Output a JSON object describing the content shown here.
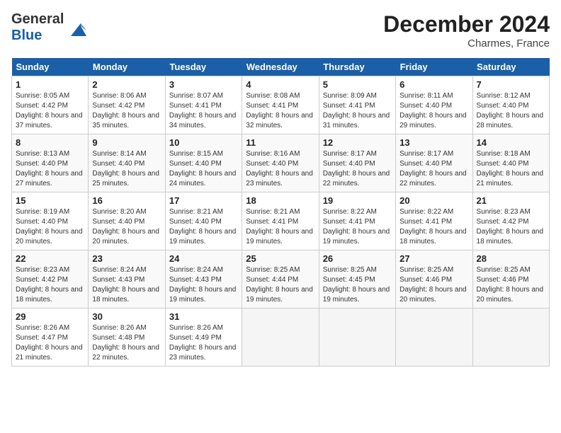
{
  "header": {
    "logo_general": "General",
    "logo_blue": "Blue",
    "month_year": "December 2024",
    "location": "Charmes, France"
  },
  "weekdays": [
    "Sunday",
    "Monday",
    "Tuesday",
    "Wednesday",
    "Thursday",
    "Friday",
    "Saturday"
  ],
  "weeks": [
    [
      {
        "day": 1,
        "sunrise": "8:05 AM",
        "sunset": "4:42 PM",
        "daylight": "8 hours and 37 minutes."
      },
      {
        "day": 2,
        "sunrise": "8:06 AM",
        "sunset": "4:42 PM",
        "daylight": "8 hours and 35 minutes."
      },
      {
        "day": 3,
        "sunrise": "8:07 AM",
        "sunset": "4:41 PM",
        "daylight": "8 hours and 34 minutes."
      },
      {
        "day": 4,
        "sunrise": "8:08 AM",
        "sunset": "4:41 PM",
        "daylight": "8 hours and 32 minutes."
      },
      {
        "day": 5,
        "sunrise": "8:09 AM",
        "sunset": "4:41 PM",
        "daylight": "8 hours and 31 minutes."
      },
      {
        "day": 6,
        "sunrise": "8:11 AM",
        "sunset": "4:40 PM",
        "daylight": "8 hours and 29 minutes."
      },
      {
        "day": 7,
        "sunrise": "8:12 AM",
        "sunset": "4:40 PM",
        "daylight": "8 hours and 28 minutes."
      }
    ],
    [
      {
        "day": 8,
        "sunrise": "8:13 AM",
        "sunset": "4:40 PM",
        "daylight": "8 hours and 27 minutes."
      },
      {
        "day": 9,
        "sunrise": "8:14 AM",
        "sunset": "4:40 PM",
        "daylight": "8 hours and 25 minutes."
      },
      {
        "day": 10,
        "sunrise": "8:15 AM",
        "sunset": "4:40 PM",
        "daylight": "8 hours and 24 minutes."
      },
      {
        "day": 11,
        "sunrise": "8:16 AM",
        "sunset": "4:40 PM",
        "daylight": "8 hours and 23 minutes."
      },
      {
        "day": 12,
        "sunrise": "8:17 AM",
        "sunset": "4:40 PM",
        "daylight": "8 hours and 22 minutes."
      },
      {
        "day": 13,
        "sunrise": "8:17 AM",
        "sunset": "4:40 PM",
        "daylight": "8 hours and 22 minutes."
      },
      {
        "day": 14,
        "sunrise": "8:18 AM",
        "sunset": "4:40 PM",
        "daylight": "8 hours and 21 minutes."
      }
    ],
    [
      {
        "day": 15,
        "sunrise": "8:19 AM",
        "sunset": "4:40 PM",
        "daylight": "8 hours and 20 minutes."
      },
      {
        "day": 16,
        "sunrise": "8:20 AM",
        "sunset": "4:40 PM",
        "daylight": "8 hours and 20 minutes."
      },
      {
        "day": 17,
        "sunrise": "8:21 AM",
        "sunset": "4:40 PM",
        "daylight": "8 hours and 19 minutes."
      },
      {
        "day": 18,
        "sunrise": "8:21 AM",
        "sunset": "4:41 PM",
        "daylight": "8 hours and 19 minutes."
      },
      {
        "day": 19,
        "sunrise": "8:22 AM",
        "sunset": "4:41 PM",
        "daylight": "8 hours and 19 minutes."
      },
      {
        "day": 20,
        "sunrise": "8:22 AM",
        "sunset": "4:41 PM",
        "daylight": "8 hours and 18 minutes."
      },
      {
        "day": 21,
        "sunrise": "8:23 AM",
        "sunset": "4:42 PM",
        "daylight": "8 hours and 18 minutes."
      }
    ],
    [
      {
        "day": 22,
        "sunrise": "8:23 AM",
        "sunset": "4:42 PM",
        "daylight": "8 hours and 18 minutes."
      },
      {
        "day": 23,
        "sunrise": "8:24 AM",
        "sunset": "4:43 PM",
        "daylight": "8 hours and 18 minutes."
      },
      {
        "day": 24,
        "sunrise": "8:24 AM",
        "sunset": "4:43 PM",
        "daylight": "8 hours and 19 minutes."
      },
      {
        "day": 25,
        "sunrise": "8:25 AM",
        "sunset": "4:44 PM",
        "daylight": "8 hours and 19 minutes."
      },
      {
        "day": 26,
        "sunrise": "8:25 AM",
        "sunset": "4:45 PM",
        "daylight": "8 hours and 19 minutes."
      },
      {
        "day": 27,
        "sunrise": "8:25 AM",
        "sunset": "4:46 PM",
        "daylight": "8 hours and 20 minutes."
      },
      {
        "day": 28,
        "sunrise": "8:25 AM",
        "sunset": "4:46 PM",
        "daylight": "8 hours and 20 minutes."
      }
    ],
    [
      {
        "day": 29,
        "sunrise": "8:26 AM",
        "sunset": "4:47 PM",
        "daylight": "8 hours and 21 minutes."
      },
      {
        "day": 30,
        "sunrise": "8:26 AM",
        "sunset": "4:48 PM",
        "daylight": "8 hours and 22 minutes."
      },
      {
        "day": 31,
        "sunrise": "8:26 AM",
        "sunset": "4:49 PM",
        "daylight": "8 hours and 23 minutes."
      },
      null,
      null,
      null,
      null
    ]
  ],
  "labels": {
    "sunrise": "Sunrise:",
    "sunset": "Sunset:",
    "daylight": "Daylight:"
  }
}
